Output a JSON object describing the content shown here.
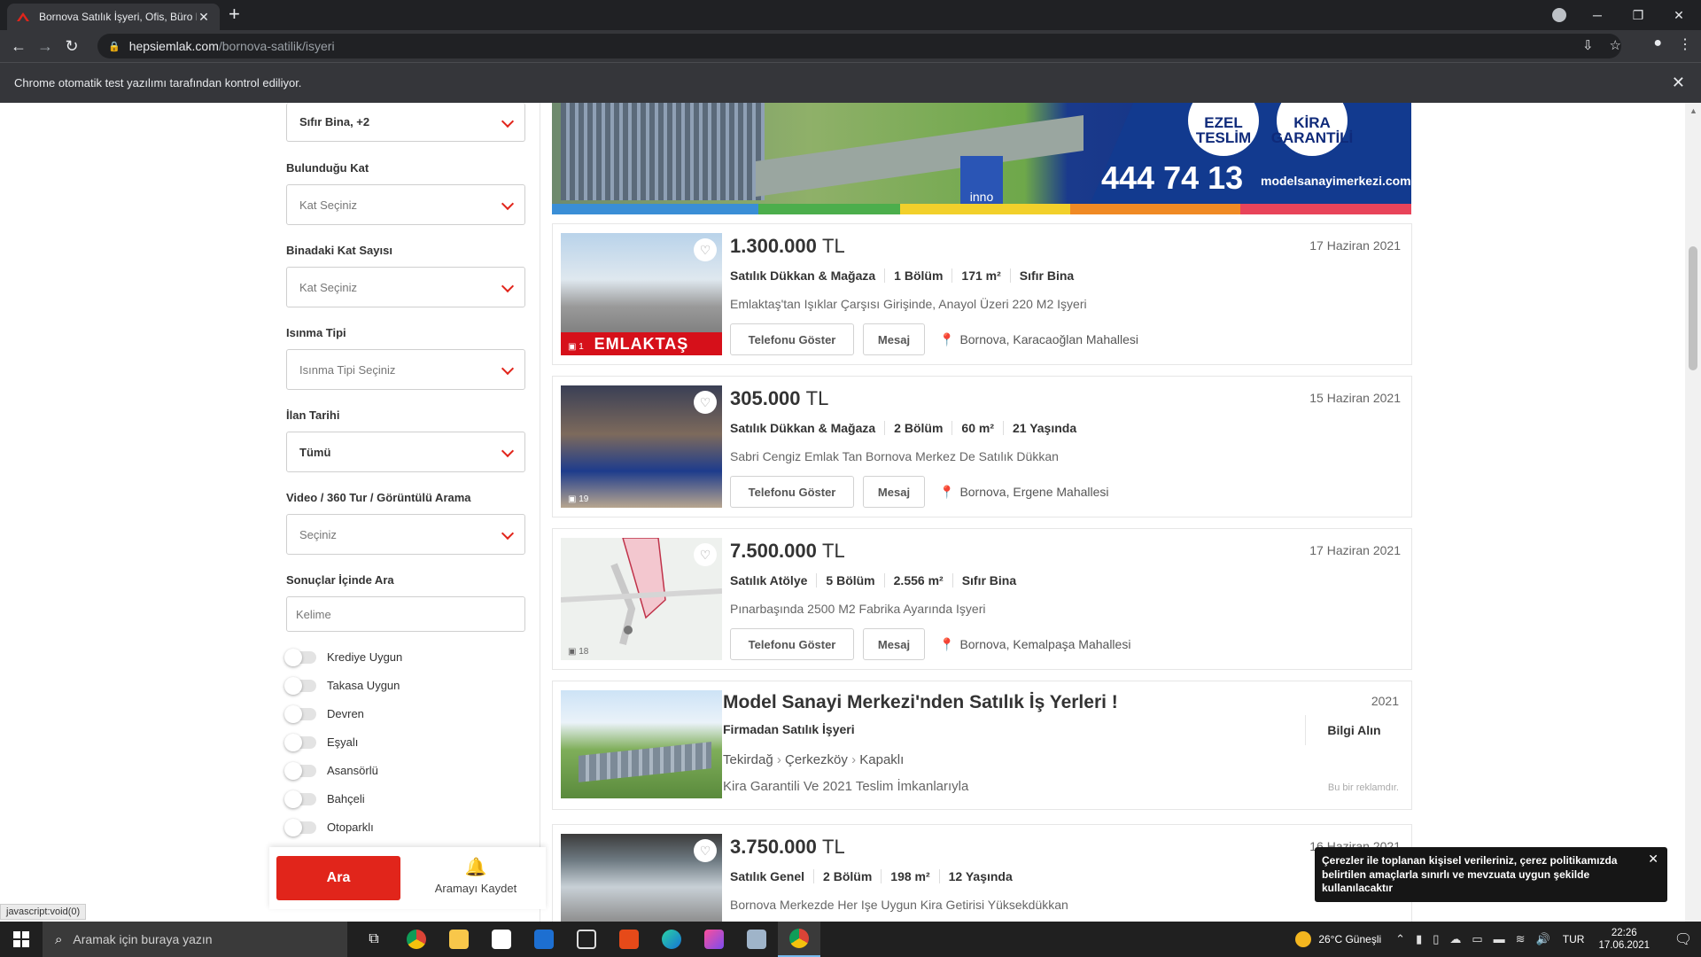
{
  "browser": {
    "tab_title": "Bornova Satılık İşyeri, Ofis, Büro F",
    "url_host": "hepsiemlak.com",
    "url_path": "/bornova-satilik/isyeri",
    "infobar_text": "Chrome otomatik test yazılımı tarafından kontrol ediliyor.",
    "status_tip": "javascript:void(0)"
  },
  "sidebar": {
    "building_status_value": "Sıfır Bina, +2",
    "floor": {
      "label": "Bulunduğu Kat",
      "value": "Kat Seçiniz"
    },
    "floor_count": {
      "label": "Binadaki Kat Sayısı",
      "value": "Kat Seçiniz"
    },
    "heating": {
      "label": "Isınma Tipi",
      "value": "Isınma Tipi Seçiniz"
    },
    "listing_date": {
      "label": "İlan Tarihi",
      "value": "Tümü"
    },
    "video": {
      "label": "Video / 360 Tur / Görüntülü Arama",
      "value": "Seçiniz"
    },
    "keyword": {
      "label": "Sonuçlar İçinde Ara",
      "placeholder": "Kelime"
    },
    "toggles": [
      "Krediye Uygun",
      "Takasa Uygun",
      "Devren",
      "Eşyalı",
      "Asansörlü",
      "Bahçeli",
      "Otoparklı"
    ],
    "search_button": "Ara",
    "save_search": "Aramayı Kaydet"
  },
  "banner": {
    "badge1": "EZEL TESLİM",
    "badge2": "KİRA GARANTİLİ",
    "phone": "444 74 13",
    "site": "modelsanayimerkezi.com",
    "inno": "inno"
  },
  "listings": [
    {
      "price": "1.300.000",
      "currency": "TL",
      "date": "17 Haziran 2021",
      "type": "Satılık Dükkan & Mağaza",
      "rooms": "1 Bölüm",
      "area": "171 m²",
      "age": "Sıfır Bina",
      "desc": "Emlaktaş'tan Işıklar Çarşısı Girişinde, Anayol Üzeri 220 M2 Işyeri",
      "location": "Bornova, Karacaoğlan Mahallesi",
      "photos": "1",
      "thumb_text": "EMLAKTAŞ"
    },
    {
      "price": "305.000",
      "currency": "TL",
      "date": "15 Haziran 2021",
      "type": "Satılık Dükkan & Mağaza",
      "rooms": "2 Bölüm",
      "area": "60 m²",
      "age": "21 Yaşında",
      "desc": "Sabri Cengiz Emlak Tan Bornova Merkez De Satılık Dükkan",
      "location": "Bornova, Ergene Mahallesi",
      "photos": "19"
    },
    {
      "price": "7.500.000",
      "currency": "TL",
      "date": "17 Haziran 2021",
      "type": "Satılık Atölye",
      "rooms": "5 Bölüm",
      "area": "2.556 m²",
      "age": "Sıfır Bina",
      "desc": "Pınarbaşında 2500 M2 Fabrika Ayarında Işyeri",
      "location": "Bornova, Kemalpaşa Mahallesi",
      "photos": "18"
    },
    {
      "price": "3.750.000",
      "currency": "TL",
      "date": "16 Haziran 2021",
      "type": "Satılık Genel",
      "rooms": "2 Bölüm",
      "area": "198 m²",
      "age": "12 Yaşında",
      "desc": "Bornova Merkezde Her Işe Uygun Kira Getirisi Yüksekdükkan"
    }
  ],
  "buttons": {
    "phone": "Telefonu Göster",
    "message": "Mesaj"
  },
  "ad": {
    "title": "Model Sanayi Merkezi'nden Satılık İş Yerleri !",
    "year": "2021",
    "subtitle": "Firmadan Satılık İşyeri",
    "cta": "Bilgi Alın",
    "crumb1": "Tekirdağ",
    "crumb2": "Çerkezköy",
    "crumb3": "Kapaklı",
    "desc": "Kira Garantili Ve 2021 Teslim İmkanlarıyla",
    "note": "Bu bir reklamdır."
  },
  "cookie": {
    "text1": "Çerezler ile toplanan kişisel verileriniz, ",
    "text_bold": "çerez politikamızda",
    "text2": " belirtilen amaçlarla sınırlı ve mevzuata uygun şekilde kullanılacaktır"
  },
  "taskbar": {
    "search_placeholder": "Aramak için buraya yazın",
    "weather": "26°C  Güneşli",
    "lang": "TUR",
    "time": "22:26",
    "date": "17.06.2021"
  },
  "colors": {
    "brand_red": "#e1251b",
    "chrome_dark": "#202124",
    "chrome_mid": "#35363a"
  }
}
